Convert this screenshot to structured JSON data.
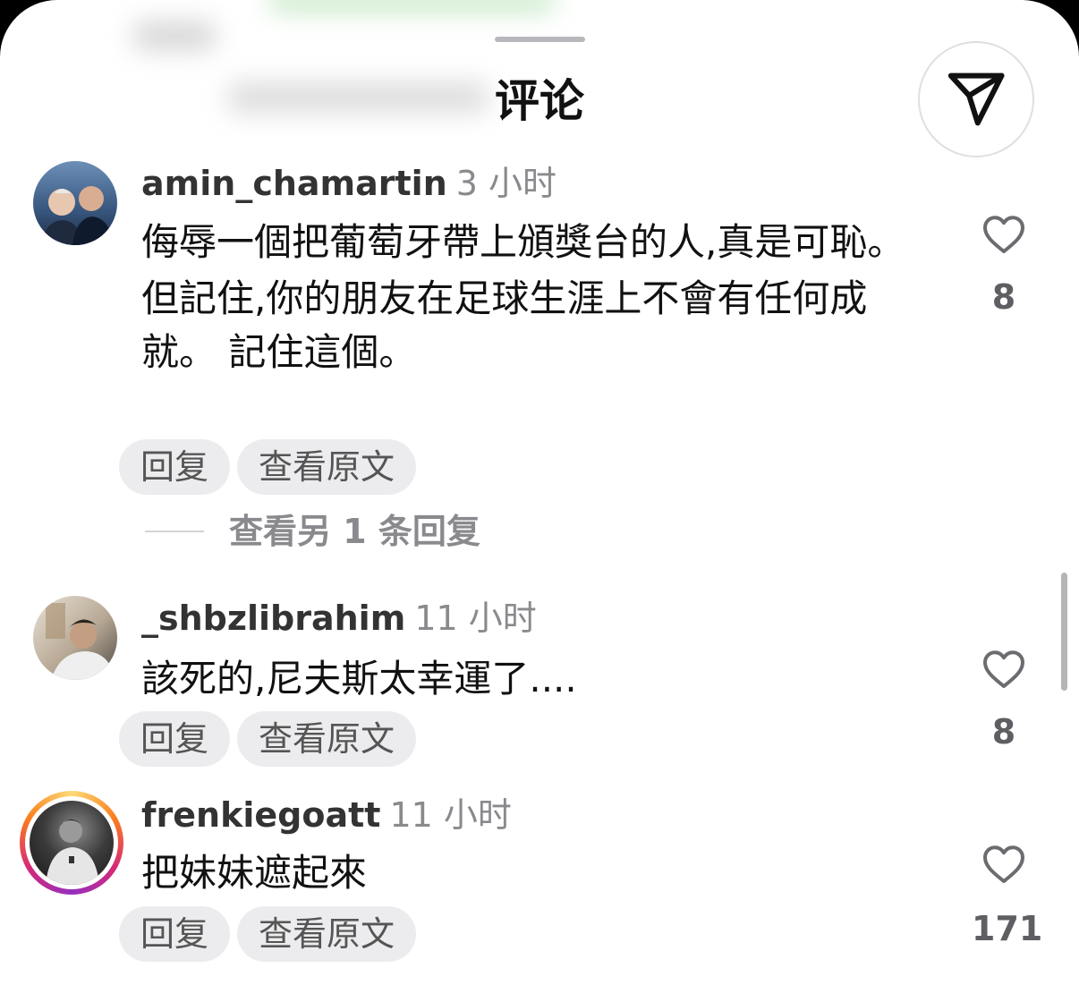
{
  "header": {
    "title": "评论",
    "share_icon": "send-icon"
  },
  "comments": [
    {
      "username": "amin_chamartin",
      "time": "3 小时",
      "paragraphs": [
        "侮辱一個把葡萄牙帶上頒獎台的人,真是可恥。",
        "但記住,你的朋友在足球生涯上不會有任何成就。 記住這個。"
      ],
      "reply_label": "回复",
      "see_original_label": "查看原文",
      "likes": "8",
      "view_replies_label": "查看另 1 条回复"
    },
    {
      "username": "_shbzlibrahim",
      "time": "11 小时",
      "paragraphs": [
        "該死的,尼夫斯太幸運了...."
      ],
      "reply_label": "回复",
      "see_original_label": "查看原文",
      "likes": "8"
    },
    {
      "username": "frenkiegoatt",
      "time": "11 小时",
      "paragraphs": [
        "把妹妹遮起來"
      ],
      "reply_label": "回复",
      "see_original_label": "查看原文",
      "likes": "171"
    }
  ],
  "colors": {
    "text": "#111111",
    "muted": "#8a8a8e",
    "chip_bg": "#ececee"
  }
}
